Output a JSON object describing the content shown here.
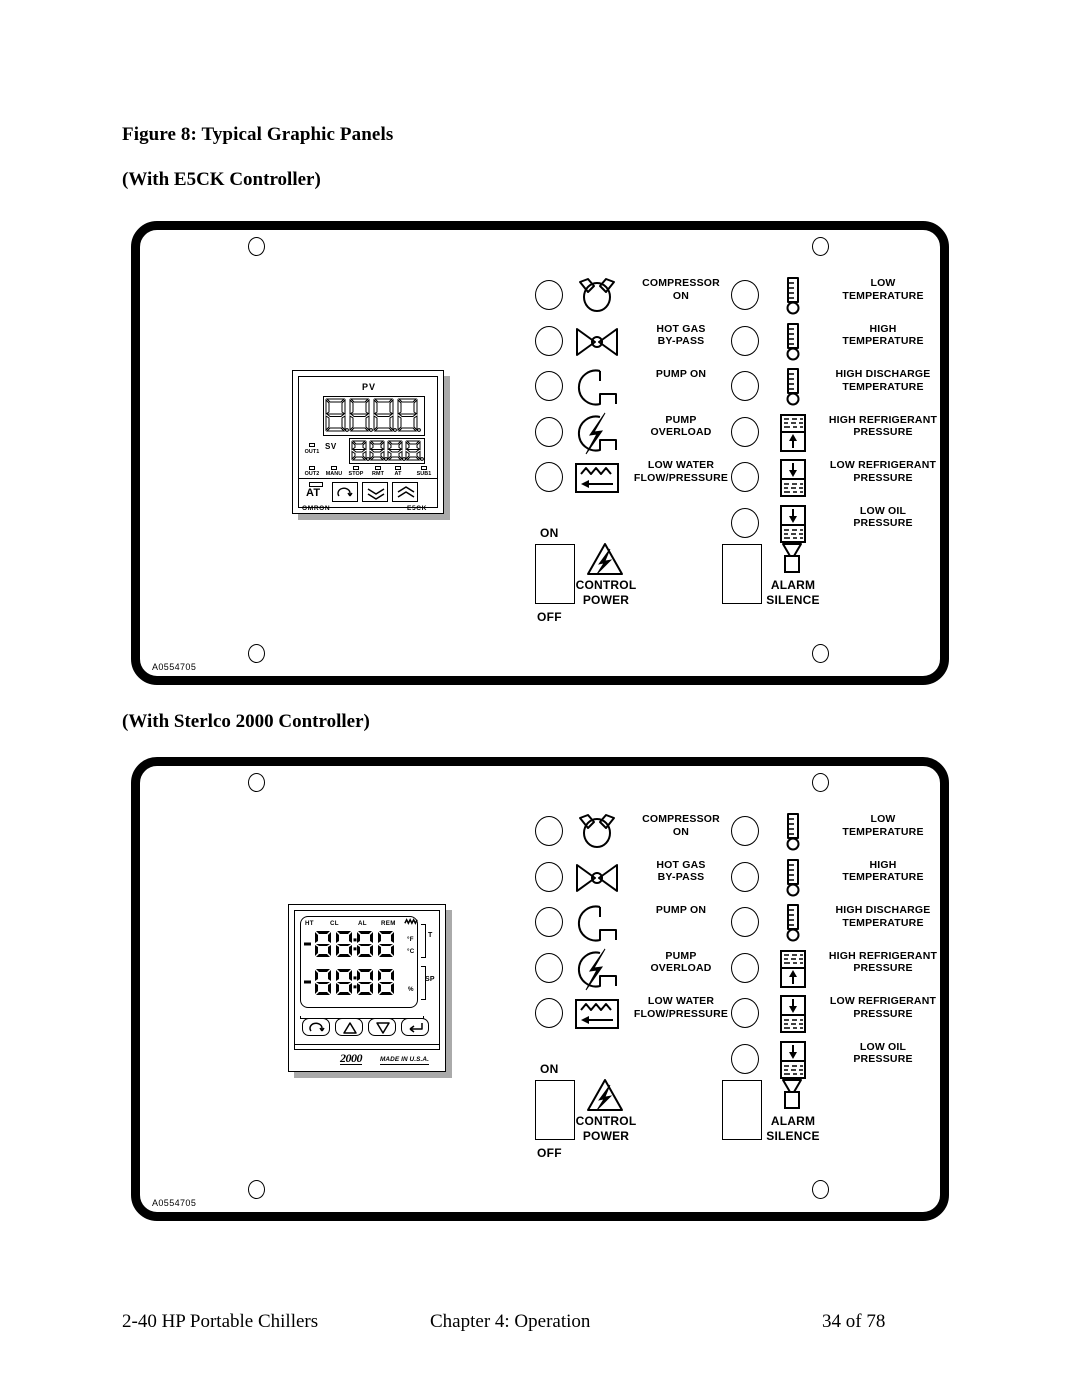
{
  "document": {
    "figure_title": "Figure 8:  Typical Graphic Panels",
    "subtitle_1": "(With E5CK Controller)",
    "subtitle_2": "(With Sterlco 2000 Controller)"
  },
  "footer": {
    "left": "2-40 HP Portable Chillers",
    "center": "Chapter 4: Operation",
    "right": "34 of 78"
  },
  "panels": [
    {
      "id": "panel-e5ck",
      "drawing_number": "A0554705",
      "controller": "e5ck"
    },
    {
      "id": "panel-sterlco-2000",
      "drawing_number": "A0554705",
      "controller": "sterlco2000"
    }
  ],
  "indicators": {
    "left_column": [
      {
        "icon": "compressor-icon",
        "label": "COMPRESSOR\nON"
      },
      {
        "icon": "hot-gas-bypass-valve-icon",
        "label": "HOT GAS\nBY-PASS"
      },
      {
        "icon": "pump-icon",
        "label": "PUMP ON"
      },
      {
        "icon": "pump-overload-icon",
        "label": "PUMP\nOVERLOAD"
      },
      {
        "icon": "water-flow-icon",
        "label": "LOW WATER\nFLOW/PRESSURE"
      }
    ],
    "right_column": [
      {
        "icon": "thermometer-icon",
        "label": "LOW\nTEMPERATURE"
      },
      {
        "icon": "thermometer-icon",
        "label": "HIGH\nTEMPERATURE"
      },
      {
        "icon": "thermometer-icon",
        "label": "HIGH DISCHARGE\nTEMPERATURE"
      },
      {
        "icon": "pressure-up-icon",
        "label": "HIGH REFRIGERANT\nPRESSURE"
      },
      {
        "icon": "pressure-down-icon",
        "label": "LOW REFRIGERANT\nPRESSURE"
      },
      {
        "icon": "pressure-down-icon",
        "label": "LOW OIL\nPRESSURE"
      }
    ]
  },
  "switches": {
    "control_power": {
      "on": "ON",
      "off": "OFF",
      "label": "CONTROL\nPOWER",
      "icon": "warning-lightning-icon"
    },
    "alarm_silence": {
      "label": "ALARM\nSILENCE",
      "icon": "horn-icon"
    }
  },
  "e5ck_controller": {
    "pv_label": "PV",
    "sv_label": "SV",
    "at_label": "AT",
    "brand_left": "OMRON",
    "brand_right": "E5CK",
    "pv_digits": "8.8.8.8",
    "sv_digits": "8.8.8.8",
    "status_leds": [
      "OUT1",
      "OUT2",
      "MANU",
      "STOP",
      "RMT",
      "AT",
      "SUB1"
    ],
    "keys": [
      "mode-key",
      "down-key",
      "up-key"
    ]
  },
  "sterlco_controller": {
    "annunciators": [
      "HT",
      "CL",
      "AL",
      "REM"
    ],
    "coil_icon": "heater-coil-icon",
    "units": [
      "°F",
      "°C",
      "%"
    ],
    "side_labels": [
      "T",
      "SP"
    ],
    "display_top": "-8.8:8.8",
    "display_bottom": "-8.8:8.8",
    "logo": "2000",
    "made_in": "MADE IN U.S.A.",
    "keys": [
      "loop-key",
      "up-arrow-key",
      "down-arrow-key",
      "enter-key"
    ]
  }
}
